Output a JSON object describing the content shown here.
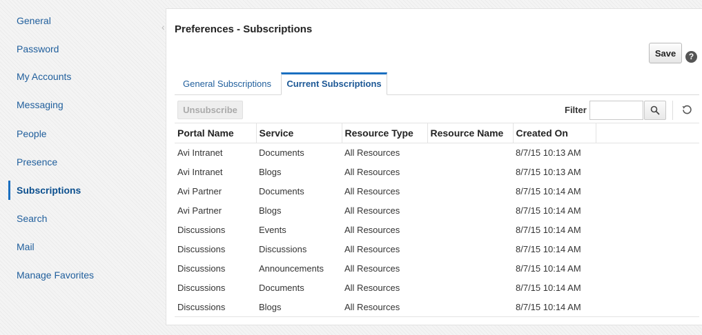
{
  "sidebar": {
    "items": [
      {
        "label": "General"
      },
      {
        "label": "Password"
      },
      {
        "label": "My Accounts"
      },
      {
        "label": "Messaging"
      },
      {
        "label": "People"
      },
      {
        "label": "Presence"
      },
      {
        "label": "Subscriptions"
      },
      {
        "label": "Search"
      },
      {
        "label": "Mail"
      },
      {
        "label": "Manage Favorites"
      }
    ],
    "active_item": "Subscriptions"
  },
  "header": {
    "title": "Preferences - Subscriptions",
    "save_label": "Save",
    "help_glyph": "?"
  },
  "tabs": [
    {
      "label": "General Subscriptions",
      "selected": false
    },
    {
      "label": "Current Subscriptions",
      "selected": true
    }
  ],
  "toolbar": {
    "unsubscribe_label": "Unsubscribe",
    "unsubscribe_enabled": false,
    "filter_label": "Filter",
    "filter_value": ""
  },
  "table": {
    "columns": [
      "Portal Name",
      "Service",
      "Resource Type",
      "Resource Name",
      "Created On"
    ],
    "rows": [
      [
        "Avi Intranet",
        "Documents",
        "All Resources",
        "",
        "8/7/15 10:13 AM"
      ],
      [
        "Avi Intranet",
        "Blogs",
        "All Resources",
        "",
        "8/7/15 10:13 AM"
      ],
      [
        "Avi Partner",
        "Documents",
        "All Resources",
        "",
        "8/7/15 10:14 AM"
      ],
      [
        "Avi Partner",
        "Blogs",
        "All Resources",
        "",
        "8/7/15 10:14 AM"
      ],
      [
        "Discussions",
        "Events",
        "All Resources",
        "",
        "8/7/15 10:14 AM"
      ],
      [
        "Discussions",
        "Discussions",
        "All Resources",
        "",
        "8/7/15 10:14 AM"
      ],
      [
        "Discussions",
        "Announcements",
        "All Resources",
        "",
        "8/7/15 10:14 AM"
      ],
      [
        "Discussions",
        "Documents",
        "All Resources",
        "",
        "8/7/15 10:14 AM"
      ],
      [
        "Discussions",
        "Blogs",
        "All Resources",
        "",
        "8/7/15 10:14 AM"
      ]
    ]
  },
  "icons": {
    "help": "help-icon",
    "search": "search-icon",
    "refresh": "refresh-icon",
    "collapse": "collapse-chevron-icon"
  },
  "colors": {
    "accent": "#1a6fc0",
    "link": "#1f5e9c"
  }
}
